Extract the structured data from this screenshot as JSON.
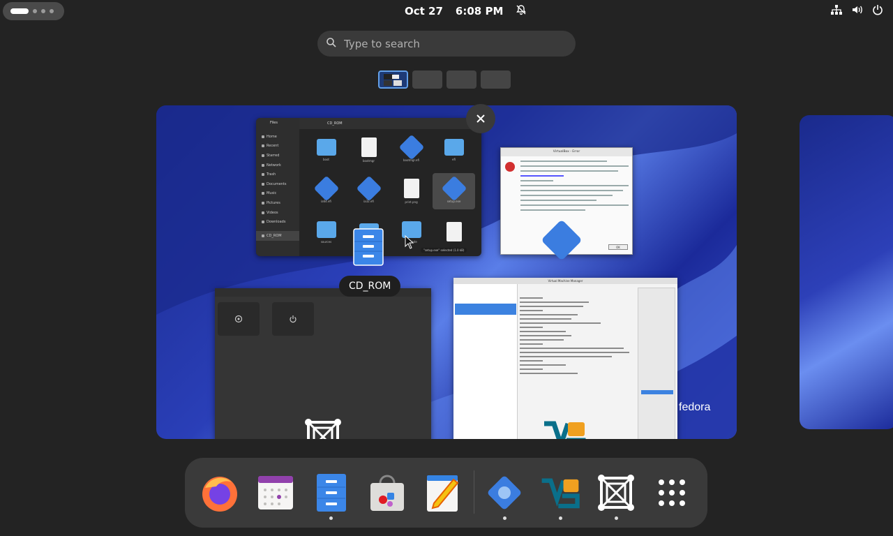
{
  "topbar": {
    "date": "Oct 27",
    "time": "6:08 PM",
    "tray_icons": [
      "network-icon",
      "volume-icon",
      "power-icon"
    ]
  },
  "search": {
    "placeholder": "Type to search"
  },
  "workspaces": {
    "count": 4,
    "active_index": 0
  },
  "windows": {
    "files": {
      "path": "CD_ROM",
      "sidebar_title": "Files",
      "sidebar_items": [
        "Home",
        "Recent",
        "Starred",
        "Network",
        "Trash",
        "Documents",
        "Music",
        "Pictures",
        "Videos",
        "Downloads",
        "CD_ROM"
      ],
      "grid_items": [
        {
          "label": "boot",
          "kind": "folder"
        },
        {
          "label": "bootmgr",
          "kind": "doc"
        },
        {
          "label": "bootmgr.efi",
          "kind": "gear"
        },
        {
          "label": "efi",
          "kind": "folder"
        },
        {
          "label": "ia64.efi",
          "kind": "gear"
        },
        {
          "label": "ia32.efi",
          "kind": "gear"
        },
        {
          "label": "print.png",
          "kind": "doc"
        },
        {
          "label": "setup.exe",
          "kind": "gear"
        },
        {
          "label": "sources",
          "kind": "folder"
        },
        {
          "label": "",
          "kind": "folder"
        },
        {
          "label": "upgrade",
          "kind": "folder"
        },
        {
          "label": "",
          "kind": "doc"
        }
      ],
      "status": "\"setup.exe\" selected (1.0 kB)"
    },
    "vbox_error": {
      "title": "VirtualBox - Error",
      "ok_label": "OK"
    },
    "vmm": {
      "title": "Virtual Machine Manager"
    }
  },
  "tooltip": {
    "label": "CD_ROM"
  },
  "wallpaper": {
    "brand": "fedora"
  },
  "dash": {
    "apps": [
      {
        "name": "firefox",
        "running": false
      },
      {
        "name": "calendar",
        "running": false
      },
      {
        "name": "files",
        "running": true
      },
      {
        "name": "software",
        "running": false
      },
      {
        "name": "text-editor",
        "running": false
      },
      {
        "name": "virtualbox",
        "running": true
      },
      {
        "name": "virt-manager",
        "running": true
      },
      {
        "name": "gnome-boxes",
        "running": true
      },
      {
        "name": "show-apps",
        "running": false
      }
    ]
  },
  "colors": {
    "accent": "#62a0ea",
    "panel": "#3a3a3a",
    "background": "#232323"
  }
}
